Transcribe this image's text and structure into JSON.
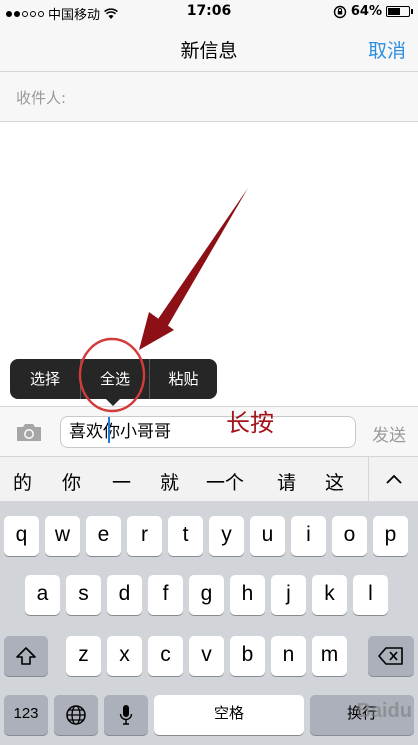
{
  "status_bar": {
    "carrier": "中国移动",
    "time": "17:06",
    "battery_percent": "64%",
    "battery_level": 0.64
  },
  "nav": {
    "title": "新信息",
    "cancel_label": "取消"
  },
  "recipient": {
    "label": "收件人:"
  },
  "edit_menu": {
    "select_label": "选择",
    "select_all_label": "全选",
    "paste_label": "粘贴"
  },
  "compose": {
    "message_text": "喜欢你小哥哥",
    "send_label": "发送"
  },
  "annotation": {
    "text": "长按",
    "color": "#a3131a"
  },
  "candidates": [
    "的",
    "你",
    "一",
    "就",
    "一个",
    "请",
    "这"
  ],
  "keyboard": {
    "row1": [
      "q",
      "w",
      "e",
      "r",
      "t",
      "y",
      "u",
      "i",
      "o",
      "p"
    ],
    "row2": [
      "a",
      "s",
      "d",
      "f",
      "g",
      "h",
      "j",
      "k",
      "l"
    ],
    "row3": [
      "z",
      "x",
      "c",
      "v",
      "b",
      "n",
      "m"
    ],
    "numbers_label": "123",
    "space_label": "空格",
    "return_label": "换行"
  },
  "watermark": "Baidu"
}
